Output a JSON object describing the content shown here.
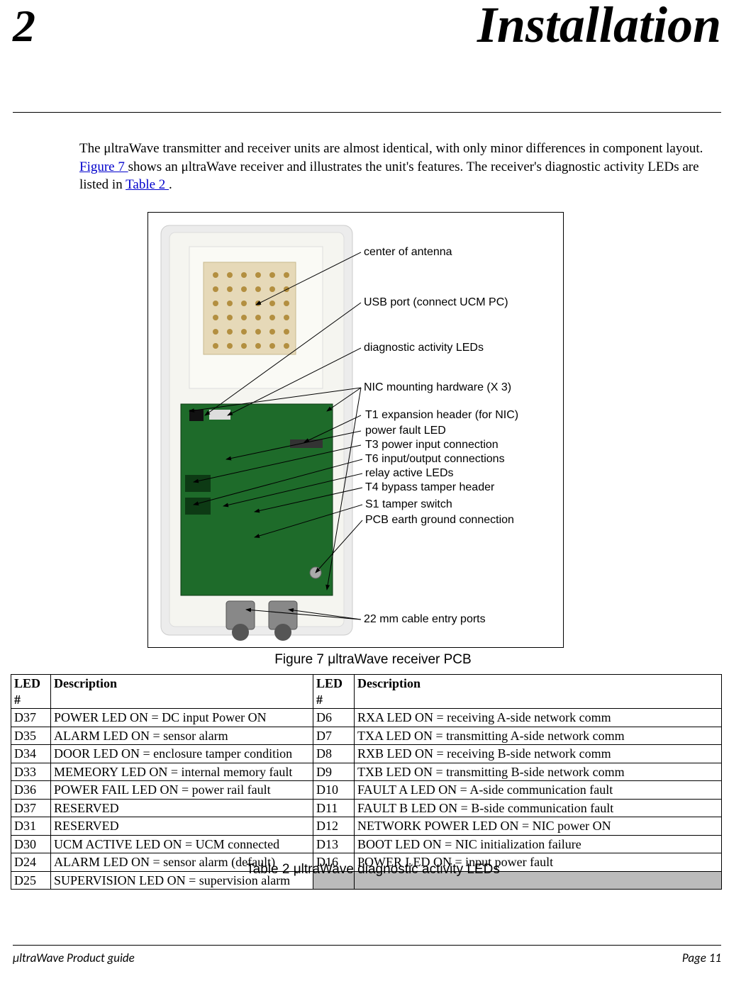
{
  "chapter": {
    "number": "2",
    "title": "Installation"
  },
  "intro": {
    "text_before": "The μltraWave transmitter and receiver units are almost identical, with only minor differences in component layout. ",
    "link1": "Figure 7 ",
    "text_mid": "shows an μltraWave receiver and illustrates the unit's features. The receiver's diagnostic activity LEDs are listed in ",
    "link2": "Table 2 ",
    "text_end": "."
  },
  "callouts": {
    "c1": "center of antenna",
    "c2": "USB port (connect UCM PC)",
    "c3": "diagnostic activity LEDs",
    "c4": "NIC mounting hardware (X 3)",
    "c5": "T1 expansion header (for NIC)",
    "c6": "power fault LED",
    "c7": "T3 power input connection",
    "c8": "T6 input/output connections",
    "c9": "relay active LEDs",
    "c10": "T4 bypass tamper header",
    "c11": "S1 tamper switch",
    "c12": "PCB earth ground connection",
    "c13": "22 mm cable entry ports"
  },
  "figure_caption": "Figure 7 μltraWave receiver PCB",
  "table": {
    "headers": {
      "h1": "LED #",
      "h2": "Description",
      "h3": "LED #",
      "h4": "Description"
    },
    "rows": [
      {
        "a": "D37",
        "b": "POWER LED ON = DC input Power ON",
        "c": "D6",
        "d": "RXA LED ON = receiving A-side network comm"
      },
      {
        "a": "D35",
        "b": "ALARM LED ON = sensor alarm",
        "c": "D7",
        "d": "TXA LED ON = transmitting A-side network comm"
      },
      {
        "a": "D34",
        "b": "DOOR LED ON = enclosure tamper condition",
        "c": "D8",
        "d": "RXB LED ON = receiving B-side network comm"
      },
      {
        "a": "D33",
        "b": "MEMEORY LED ON = internal memory fault",
        "c": "D9",
        "d": "TXB LED ON = transmitting B-side network comm"
      },
      {
        "a": "D36",
        "b": "POWER FAIL LED ON = power rail fault",
        "c": "D10",
        "d": "FAULT A LED ON = A-side communication fault"
      },
      {
        "a": "D37",
        "b": "RESERVED",
        "c": "D11",
        "d": "FAULT B LED ON = B-side communication fault"
      },
      {
        "a": "D31",
        "b": "RESERVED",
        "c": "D12",
        "d": "NETWORK POWER LED ON = NIC power ON"
      },
      {
        "a": "D30",
        "b": "UCM ACTIVE LED ON = UCM connected",
        "c": "D13",
        "d": "BOOT LED ON = NIC initialization failure"
      },
      {
        "a": "D24",
        "b": "ALARM LED ON = sensor alarm (default)",
        "c": "D16",
        "d": "POWER LED ON = input power fault"
      },
      {
        "a": "D25",
        "b": "SUPERVISION LED ON = supervision alarm",
        "c": "",
        "d": ""
      }
    ]
  },
  "table_caption": "Table 2 μltraWave diagnostic activity LEDs",
  "footer": {
    "left": "μltraWave Product guide",
    "right": "Page 11"
  }
}
